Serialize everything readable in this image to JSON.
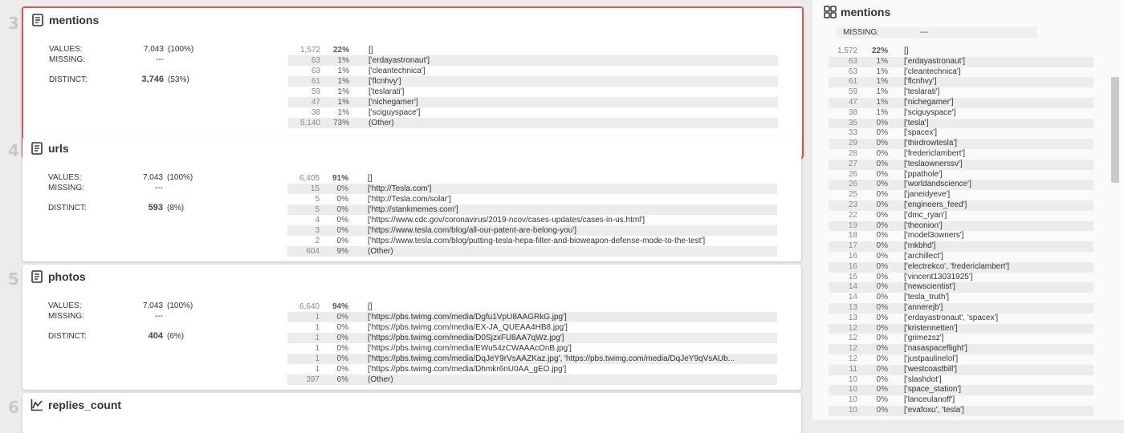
{
  "cards": [
    {
      "num": "3",
      "title": "mentions",
      "icon": "document-icon",
      "stats": {
        "values_label": "VALUES:",
        "values": "7,043",
        "values_pct": "(100%)",
        "missing_label": "MISSING:",
        "missing": "---",
        "distinct_label": "DISTINCT:",
        "distinct": "3,746",
        "distinct_pct": "(53%)"
      },
      "freq": [
        {
          "count": "1,572",
          "pct": "22%",
          "value": "[]"
        },
        {
          "count": "63",
          "pct": "1%",
          "value": "['erdayastronaut']"
        },
        {
          "count": "63",
          "pct": "1%",
          "value": "['cleantechnica']"
        },
        {
          "count": "61",
          "pct": "1%",
          "value": "['flcnhvy']"
        },
        {
          "count": "59",
          "pct": "1%",
          "value": "['teslarati']"
        },
        {
          "count": "47",
          "pct": "1%",
          "value": "['nichegamer']"
        },
        {
          "count": "38",
          "pct": "1%",
          "value": "['sciguyspace']"
        },
        {
          "count": "5,140",
          "pct": "73%",
          "value": "(Other)"
        }
      ]
    },
    {
      "num": "4",
      "title": "urls",
      "icon": "document-icon",
      "stats": {
        "values_label": "VALUES:",
        "values": "7,043",
        "values_pct": "(100%)",
        "missing_label": "MISSING:",
        "missing": "---",
        "distinct_label": "DISTINCT:",
        "distinct": "593",
        "distinct_pct": "(8%)"
      },
      "freq": [
        {
          "count": "6,405",
          "pct": "91%",
          "value": "[]"
        },
        {
          "count": "15",
          "pct": "0%",
          "value": "['http://Tesla.com']"
        },
        {
          "count": "5",
          "pct": "0%",
          "value": "['http://Tesla.com/solar']"
        },
        {
          "count": "5",
          "pct": "0%",
          "value": "['http://stankmemes.com']"
        },
        {
          "count": "4",
          "pct": "0%",
          "value": "['https://www.cdc.gov/coronavirus/2019-ncov/cases-updates/cases-in-us.html']"
        },
        {
          "count": "3",
          "pct": "0%",
          "value": "['https://www.tesla.com/blog/all-our-patent-are-belong-you']"
        },
        {
          "count": "2",
          "pct": "0%",
          "value": "['https://www.tesla.com/blog/putting-tesla-hepa-filter-and-bioweapon-defense-mode-to-the-test']"
        },
        {
          "count": "604",
          "pct": "9%",
          "value": "(Other)"
        }
      ]
    },
    {
      "num": "5",
      "title": "photos",
      "icon": "document-icon",
      "stats": {
        "values_label": "VALUES:",
        "values": "7,043",
        "values_pct": "(100%)",
        "missing_label": "MISSING:",
        "missing": "---",
        "distinct_label": "DISTINCT:",
        "distinct": "404",
        "distinct_pct": "(6%)"
      },
      "freq": [
        {
          "count": "6,640",
          "pct": "94%",
          "value": "[]"
        },
        {
          "count": "1",
          "pct": "0%",
          "value": "['https://pbs.twimg.com/media/Dgfu1VpU8AAGRkG.jpg']"
        },
        {
          "count": "1",
          "pct": "0%",
          "value": "['https://pbs.twimg.com/media/EX-JA_QUEAA4HB8.jpg']"
        },
        {
          "count": "1",
          "pct": "0%",
          "value": "['https://pbs.twimg.com/media/D0SjzxFU8AA7qWz.jpg']"
        },
        {
          "count": "1",
          "pct": "0%",
          "value": "['https://pbs.twimg.com/media/EWu54zCWAAAcOnB.jpg']"
        },
        {
          "count": "1",
          "pct": "0%",
          "value": "['https://pbs.twimg.com/media/DqJeY9rVsAAZKaz.jpg', 'https://pbs.twimg.com/media/DqJeY9qVsAUb..."
        },
        {
          "count": "1",
          "pct": "0%",
          "value": "['https://pbs.twimg.com/media/Dhmkr6nU0AA_gEO.jpg']"
        },
        {
          "count": "397",
          "pct": "6%",
          "value": "(Other)"
        }
      ]
    },
    {
      "num": "6",
      "title": "replies_count",
      "icon": "line-chart-icon"
    }
  ],
  "right_panel": {
    "title": "mentions",
    "icon": "grid-icon",
    "missing_label": "MISSING:",
    "missing_value": "---",
    "freq": [
      {
        "count": "1,572",
        "pct": "22%",
        "value": "[]"
      },
      {
        "count": "63",
        "pct": "1%",
        "value": "['erdayastronaut']"
      },
      {
        "count": "63",
        "pct": "1%",
        "value": "['cleantechnica']"
      },
      {
        "count": "61",
        "pct": "1%",
        "value": "['flcnhvy']"
      },
      {
        "count": "59",
        "pct": "1%",
        "value": "['teslarati']"
      },
      {
        "count": "47",
        "pct": "1%",
        "value": "['nichegamer']"
      },
      {
        "count": "38",
        "pct": "1%",
        "value": "['sciguyspace']"
      },
      {
        "count": "35",
        "pct": "0%",
        "value": "['tesla']"
      },
      {
        "count": "33",
        "pct": "0%",
        "value": "['spacex']"
      },
      {
        "count": "29",
        "pct": "0%",
        "value": "['thirdrowtesla']"
      },
      {
        "count": "28",
        "pct": "0%",
        "value": "['fredericlambert']"
      },
      {
        "count": "27",
        "pct": "0%",
        "value": "['teslaownerssv']"
      },
      {
        "count": "26",
        "pct": "0%",
        "value": "['ppathole']"
      },
      {
        "count": "26",
        "pct": "0%",
        "value": "['worldandscience']"
      },
      {
        "count": "25",
        "pct": "0%",
        "value": "['janeidyeve']"
      },
      {
        "count": "23",
        "pct": "0%",
        "value": "['engineers_feed']"
      },
      {
        "count": "22",
        "pct": "0%",
        "value": "['dmc_ryan']"
      },
      {
        "count": "19",
        "pct": "0%",
        "value": "['theonion']"
      },
      {
        "count": "18",
        "pct": "0%",
        "value": "['model3owners']"
      },
      {
        "count": "17",
        "pct": "0%",
        "value": "['mkbhd']"
      },
      {
        "count": "16",
        "pct": "0%",
        "value": "['archillect']"
      },
      {
        "count": "16",
        "pct": "0%",
        "value": "['electrekco', 'fredericlambert']"
      },
      {
        "count": "15",
        "pct": "0%",
        "value": "['vincent13031925']"
      },
      {
        "count": "14",
        "pct": "0%",
        "value": "['newscientist']"
      },
      {
        "count": "14",
        "pct": "0%",
        "value": "['tesla_truth']"
      },
      {
        "count": "13",
        "pct": "0%",
        "value": "['annerejb']"
      },
      {
        "count": "13",
        "pct": "0%",
        "value": "['erdayastronaut', 'spacex']"
      },
      {
        "count": "12",
        "pct": "0%",
        "value": "['kristennetten']"
      },
      {
        "count": "12",
        "pct": "0%",
        "value": "['grimezsz']"
      },
      {
        "count": "12",
        "pct": "0%",
        "value": "['nasaspaceflight']"
      },
      {
        "count": "12",
        "pct": "0%",
        "value": "['justpaulinelol']"
      },
      {
        "count": "11",
        "pct": "0%",
        "value": "['westcoastbill']"
      },
      {
        "count": "10",
        "pct": "0%",
        "value": "['slashdot']"
      },
      {
        "count": "10",
        "pct": "0%",
        "value": "['space_station']"
      },
      {
        "count": "10",
        "pct": "0%",
        "value": "['lanceulanoff']"
      },
      {
        "count": "10",
        "pct": "0%",
        "value": "['evafoxu', 'tesla']"
      }
    ]
  }
}
